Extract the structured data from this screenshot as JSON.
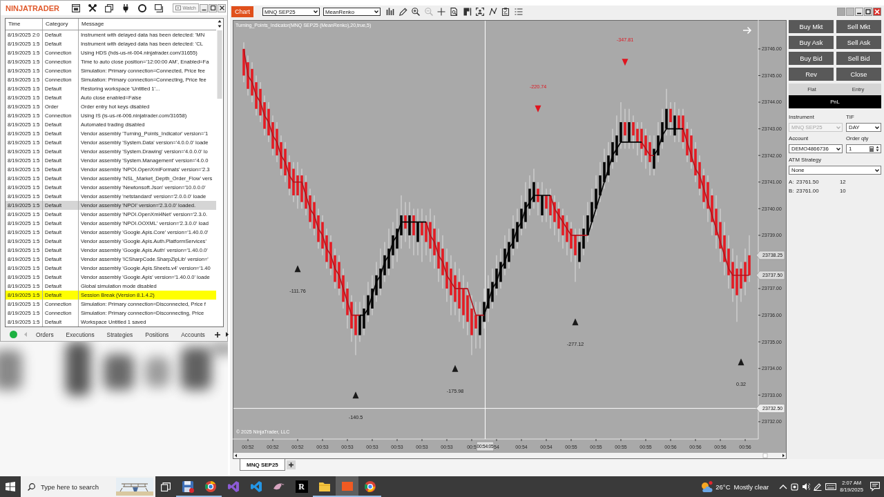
{
  "control_center": {
    "logo": "NINJATRADER",
    "watch_button": "Watch",
    "log": {
      "columns": [
        "Time",
        "Category",
        "Message"
      ],
      "rows": [
        {
          "time": "8/19/2025 2:0",
          "category": "Default",
          "message": "Instrument with delayed data has been detected: 'MN",
          "selected": false
        },
        {
          "time": "8/19/2025 1:5",
          "category": "Default",
          "message": "Instrument with delayed data has been detected: 'CL",
          "selected": false
        },
        {
          "time": "8/19/2025 1:5",
          "category": "Connection",
          "message": "Using HDS (hds-us-nt-004.ninjatrader.com/31655)",
          "selected": false
        },
        {
          "time": "8/19/2025 1:5",
          "category": "Connection",
          "message": "Time to auto close position='12:00:00 AM', Enabled=Fa",
          "selected": false
        },
        {
          "time": "8/19/2025 1:5",
          "category": "Connection",
          "message": "Simulation: Primary connection=Connected, Price fee",
          "selected": false
        },
        {
          "time": "8/19/2025 1:5",
          "category": "Connection",
          "message": "Simulation: Primary connection=Connecting, Price fee",
          "selected": false
        },
        {
          "time": "8/19/2025 1:5",
          "category": "Default",
          "message": "Restoring workspace 'Untitled 1'...",
          "selected": false
        },
        {
          "time": "8/19/2025 1:5",
          "category": "Default",
          "message": "Auto close enabled=False",
          "selected": false
        },
        {
          "time": "8/19/2025 1:5",
          "category": "Order",
          "message": "Order entry hot keys disabled",
          "selected": false
        },
        {
          "time": "8/19/2025 1:5",
          "category": "Connection",
          "message": "Using IS (is-us-nt-006.ninjatrader.com/31658)",
          "selected": false
        },
        {
          "time": "8/19/2025 1:5",
          "category": "Default",
          "message": "Automated trading disabled",
          "selected": false
        },
        {
          "time": "8/19/2025 1:5",
          "category": "Default",
          "message": "Vendor assembly 'Turning_Points_Indicator' version='1",
          "selected": false
        },
        {
          "time": "8/19/2025 1:5",
          "category": "Default",
          "message": "Vendor assembly 'System.Data' version='4.0.0.0' loade",
          "selected": false
        },
        {
          "time": "8/19/2025 1:5",
          "category": "Default",
          "message": "Vendor assembly 'System.Drawing' version='4.0.0.0' lo",
          "selected": false
        },
        {
          "time": "8/19/2025 1:5",
          "category": "Default",
          "message": "Vendor assembly 'System.Management' version='4.0.0",
          "selected": false
        },
        {
          "time": "8/19/2025 1:5",
          "category": "Default",
          "message": "Vendor assembly 'NPOI.OpenXmlFormats' version='2.3",
          "selected": false
        },
        {
          "time": "8/19/2025 1:5",
          "category": "Default",
          "message": "Vendor assembly 'NSL_Market_Depth_Order_Flow' vers",
          "selected": false
        },
        {
          "time": "8/19/2025 1:5",
          "category": "Default",
          "message": "Vendor assembly 'Newtonsoft.Json' version='10.0.0.0'",
          "selected": false
        },
        {
          "time": "8/19/2025 1:5",
          "category": "Default",
          "message": "Vendor assembly 'netstandard' version='2.0.0.0' loade",
          "selected": false
        },
        {
          "time": "8/19/2025 1:5",
          "category": "Default",
          "message": "Vendor assembly 'NPOI' version='2.3.0.0' loaded.",
          "selected": true
        },
        {
          "time": "8/19/2025 1:5",
          "category": "Default",
          "message": "Vendor assembly 'NPOI.OpenXml4Net' version='2.3.0.",
          "selected": false
        },
        {
          "time": "8/19/2025 1:5",
          "category": "Default",
          "message": "Vendor assembly 'NPOI.OOXML' version='2.3.0.0' load",
          "selected": false
        },
        {
          "time": "8/19/2025 1:5",
          "category": "Default",
          "message": "Vendor assembly 'Google.Apis.Core' version='1.40.0.0'",
          "selected": false
        },
        {
          "time": "8/19/2025 1:5",
          "category": "Default",
          "message": "Vendor assembly 'Google.Apis.Auth.PlatformServices'",
          "selected": false
        },
        {
          "time": "8/19/2025 1:5",
          "category": "Default",
          "message": "Vendor assembly 'Google.Apis.Auth' version='1.40.0.0'",
          "selected": false
        },
        {
          "time": "8/19/2025 1:5",
          "category": "Default",
          "message": "Vendor assembly 'ICSharpCode.SharpZipLib' version='",
          "selected": false
        },
        {
          "time": "8/19/2025 1:5",
          "category": "Default",
          "message": "Vendor assembly 'Google.Apis.Sheets.v4' version='1.40",
          "selected": false
        },
        {
          "time": "8/19/2025 1:5",
          "category": "Default",
          "message": "Vendor assembly 'Google.Apis' version='1.40.0.0' loade",
          "selected": false
        },
        {
          "time": "8/19/2025 1:5",
          "category": "Default",
          "message": "Global simulation mode disabled",
          "selected": false
        },
        {
          "time": "8/19/2025 1:5",
          "category": "Default",
          "message": "Session Break (Version 8.1.4.2)",
          "selected": false,
          "color": "#ffff00"
        },
        {
          "time": "8/19/2025 1:5",
          "category": "Connection",
          "message": "Simulation: Primary connection=Disconnected, Price f",
          "selected": false
        },
        {
          "time": "8/19/2025 1:5",
          "category": "Connection",
          "message": "Simulation: Primary connection=Disconnecting, Price",
          "selected": false
        },
        {
          "time": "8/19/2025 1:5",
          "category": "Default",
          "message": "Workspace Untitled 1 saved",
          "selected": false
        }
      ]
    },
    "connected": true,
    "tabs": [
      {
        "label": "Orders",
        "selected": false
      },
      {
        "label": "Executions",
        "selected": false
      },
      {
        "label": "Strategies",
        "selected": false
      },
      {
        "label": "Positions",
        "selected": false
      },
      {
        "label": "Accounts",
        "selected": false
      }
    ]
  },
  "chart_window": {
    "chart_label": "Chart",
    "instrument": "MNQ SEP25",
    "bar_type": "MeanRenko",
    "tools": [
      {
        "kind": "bars",
        "disabled": false
      },
      {
        "kind": "pencil",
        "disabled": false
      },
      {
        "kind": "zoom-in",
        "disabled": false
      },
      {
        "kind": "zoom-out",
        "disabled": true
      },
      {
        "kind": "crosshair",
        "disabled": false
      },
      {
        "kind": "data-box",
        "disabled": false
      },
      {
        "kind": "flag",
        "disabled": false
      },
      {
        "kind": "capture",
        "disabled": false
      },
      {
        "kind": "zigzag",
        "disabled": false
      },
      {
        "kind": "clipboard",
        "disabled": false
      },
      {
        "kind": "list",
        "disabled": false
      }
    ],
    "chart": {
      "copyright": "© 2025 NinjaTrader, LLC",
      "crosshair_time": "00:54:05",
      "chart_data": {
        "type": "candlestick",
        "title": "Turning_Points_Indicator(MNQ SEP25 (MeanRenko),20,true,5)",
        "categories": [
          null,
          "00:52",
          null,
          null,
          null,
          null,
          null,
          "00:52",
          null,
          null,
          null,
          null,
          null,
          "00:52",
          null,
          null,
          null,
          null,
          null,
          "00:53",
          null,
          null,
          null,
          null,
          null,
          "00:53",
          null,
          null,
          null,
          null,
          null,
          "00:53",
          null,
          null,
          null,
          null,
          null,
          "00:53",
          null,
          null,
          null,
          null,
          null,
          "00:53",
          null,
          null,
          null,
          null,
          null,
          "00:53",
          null,
          null,
          null,
          null,
          null,
          "00:5",
          null,
          null,
          null,
          null,
          null,
          "54",
          null,
          null,
          null,
          null,
          null,
          "00:54",
          null,
          null,
          null,
          null,
          null,
          "00:54",
          null,
          null,
          null,
          null,
          null,
          "00:55",
          null,
          null,
          null,
          null,
          null,
          "00:55",
          null,
          null,
          null,
          null,
          null,
          "00:55",
          null,
          null,
          null,
          null,
          null,
          "00:55",
          null,
          null,
          null,
          null,
          null,
          "00:56",
          null,
          null,
          null,
          null,
          null,
          "00:56",
          null,
          null,
          null,
          null,
          null,
          "00:56",
          null,
          null,
          null,
          null,
          null,
          "00:56",
          null
        ],
        "ohlc": [
          [
            23746,
            23746.25,
            23744.75,
            23745
          ],
          [
            23745.5,
            23745.75,
            23744.25,
            23744.5
          ],
          [
            23745.25,
            23745.5,
            23744,
            23744.25
          ],
          [
            23744.75,
            23745,
            23743.5,
            23743.75
          ],
          [
            23744.5,
            23744.75,
            23743.25,
            23743.5
          ],
          [
            23744,
            23744.25,
            23742.75,
            23743
          ],
          [
            23743.75,
            23744,
            23742.5,
            23742.75
          ],
          [
            23743.25,
            23743.5,
            23742,
            23742.25
          ],
          [
            23743,
            23743.25,
            23741.75,
            23742
          ],
          [
            23742.5,
            23742.75,
            23741.25,
            23741.5
          ],
          [
            23742.25,
            23742.5,
            23741,
            23741.25
          ],
          [
            23741.75,
            23742,
            23740.5,
            23740.75
          ],
          [
            23741.5,
            23741.75,
            23740.25,
            23740.5
          ],
          [
            23741.25,
            23741.75,
            23740,
            23740.5
          ],
          [
            23741.25,
            23741.5,
            23740,
            23740.25
          ],
          [
            23741,
            23741.25,
            23739.75,
            23740
          ],
          [
            23740.5,
            23740.75,
            23739.25,
            23739.5
          ],
          [
            23740.25,
            23740.5,
            23739,
            23739.25
          ],
          [
            23739.75,
            23740,
            23738.5,
            23738.75
          ],
          [
            23739.5,
            23739.75,
            23738.25,
            23738.5
          ],
          [
            23739,
            23739.25,
            23737.75,
            23738
          ],
          [
            23738.75,
            23739,
            23737.5,
            23737.75
          ],
          [
            23738.25,
            23738.5,
            23737,
            23737.25
          ],
          [
            23738,
            23738.25,
            23736.75,
            23737
          ],
          [
            23737.5,
            23737.75,
            23736.25,
            23736.5
          ],
          [
            23737,
            23737.25,
            23735.5,
            23736
          ],
          [
            23736.5,
            23736.75,
            23735,
            23735.5
          ],
          [
            23736,
            23736.5,
            23734.5,
            23735.25
          ],
          [
            23735.25,
            23736.5,
            23735,
            23736
          ],
          [
            23735.5,
            23736.75,
            23735.25,
            23736.25
          ],
          [
            23736,
            23737.25,
            23735.75,
            23736.75
          ],
          [
            23736.25,
            23737.5,
            23736,
            23737
          ],
          [
            23736.75,
            23738,
            23736.5,
            23737.5
          ],
          [
            23737,
            23738.5,
            23736.75,
            23737.75
          ],
          [
            23737.5,
            23738.75,
            23737.25,
            23738.25
          ],
          [
            23737.75,
            23739.25,
            23737.5,
            23738.5
          ],
          [
            23738.25,
            23739.5,
            23737.75,
            23739
          ],
          [
            23738.5,
            23740,
            23738,
            23739.25
          ],
          [
            23739,
            23740.5,
            23738.5,
            23739.75
          ],
          [
            23739.75,
            23740.25,
            23738.75,
            23739.25
          ],
          [
            23739,
            23740.25,
            23738.5,
            23739.75
          ],
          [
            23739.75,
            23740,
            23738.25,
            23739
          ],
          [
            23738.75,
            23740,
            23738.25,
            23739.5
          ],
          [
            23739.5,
            23740,
            23738,
            23739
          ],
          [
            23739.5,
            23739.75,
            23738.25,
            23738.75
          ],
          [
            23739.5,
            23740,
            23738,
            23738.5
          ],
          [
            23739.25,
            23739.75,
            23737.75,
            23738.25
          ],
          [
            23738.75,
            23739.25,
            23737.25,
            23737.75
          ],
          [
            23738.5,
            23739,
            23737,
            23737.5
          ],
          [
            23738,
            23738.5,
            23736.5,
            23737
          ],
          [
            23737.75,
            23738.25,
            23736,
            23736.75
          ],
          [
            23737.5,
            23738,
            23736,
            23736.5
          ],
          [
            23737.25,
            23737.75,
            23735.75,
            23736.25
          ],
          [
            23737,
            23737.5,
            23735.5,
            23736
          ],
          [
            23736.75,
            23737.25,
            23735.25,
            23735.75
          ],
          [
            23736.25,
            23736.75,
            23734.5,
            23735.25
          ],
          [
            23736,
            23736.5,
            23734.75,
            23735.5
          ],
          [
            23735.25,
            23736.5,
            23734.75,
            23736
          ],
          [
            23735.75,
            23737,
            23735.5,
            23736.5
          ],
          [
            23736.25,
            23737.5,
            23735.75,
            23737
          ],
          [
            23736.5,
            23737.75,
            23736.25,
            23737.25
          ],
          [
            23737,
            23738.25,
            23736.75,
            23737.75
          ],
          [
            23737.25,
            23738.5,
            23737,
            23738
          ],
          [
            23737.75,
            23739,
            23737.5,
            23738.5
          ],
          [
            23738,
            23739.25,
            23737.75,
            23738.75
          ],
          [
            23738.5,
            23739.75,
            23738.25,
            23739.25
          ],
          [
            23738.75,
            23740,
            23738.5,
            23739.5
          ],
          [
            23739.25,
            23740.5,
            23739,
            23740
          ],
          [
            23739.5,
            23741,
            23739.25,
            23740.25
          ],
          [
            23740,
            23741.25,
            23739.75,
            23740.75
          ],
          [
            23740.25,
            23741.5,
            23740,
            23741
          ],
          [
            23740.75,
            23741,
            23739.75,
            23740.25
          ],
          [
            23739.75,
            23741,
            23739.5,
            23740.5
          ],
          [
            23740.5,
            23740.75,
            23739.5,
            23740
          ],
          [
            23740.5,
            23740.75,
            23739.25,
            23739.75
          ],
          [
            23740.25,
            23740.5,
            23739,
            23739.5
          ],
          [
            23740,
            23740.25,
            23738.75,
            23739.25
          ],
          [
            23739.75,
            23740,
            23738.5,
            23739
          ],
          [
            23739.5,
            23739.75,
            23738.25,
            23738.75
          ],
          [
            23739.25,
            23739.5,
            23738,
            23738.5
          ],
          [
            23739,
            23739.25,
            23737.25,
            23738.25
          ],
          [
            23738,
            23739.25,
            23737.75,
            23738.75
          ],
          [
            23738.5,
            23739.75,
            23738.25,
            23739.25
          ],
          [
            23739,
            23740.25,
            23738.75,
            23739.75
          ],
          [
            23739.5,
            23740.75,
            23739.25,
            23740.25
          ],
          [
            23740,
            23741.25,
            23739.75,
            23740.75
          ],
          [
            23740.5,
            23741.75,
            23740.25,
            23741.25
          ],
          [
            23741,
            23742.25,
            23740.75,
            23741.75
          ],
          [
            23741.25,
            23742.5,
            23741,
            23742
          ],
          [
            23741.75,
            23743,
            23741.5,
            23742.5
          ],
          [
            23742,
            23743.5,
            23741.75,
            23742.75
          ],
          [
            23742.5,
            23744,
            23742.25,
            23743.25
          ],
          [
            23743.25,
            23743.75,
            23742.25,
            23742.75
          ],
          [
            23742.5,
            23743.75,
            23742.25,
            23743.25
          ],
          [
            23743.25,
            23743.5,
            23742.25,
            23742.75
          ],
          [
            23743,
            23743.25,
            23742,
            23742.5
          ],
          [
            23743,
            23743.25,
            23741.75,
            23742.25
          ],
          [
            23742.75,
            23743,
            23741.5,
            23742
          ],
          [
            23742.5,
            23742.75,
            23741.25,
            23741.75
          ],
          [
            23741.5,
            23742.75,
            23741.25,
            23742.25
          ],
          [
            23742,
            23743.25,
            23741.75,
            23742.75
          ],
          [
            23742.5,
            23743.75,
            23742.25,
            23743.25
          ],
          [
            23743,
            23744.5,
            23742.75,
            23743.75
          ],
          [
            23743.75,
            23744,
            23742.75,
            23743.25
          ],
          [
            23742.75,
            23744,
            23742.5,
            23743.5
          ],
          [
            23743.5,
            23743.75,
            23742.5,
            23743
          ],
          [
            23743.5,
            23743.75,
            23742.25,
            23742.5
          ],
          [
            23743,
            23743.25,
            23741.75,
            23742
          ],
          [
            23742.75,
            23743,
            23741.5,
            23741.75
          ],
          [
            23742.25,
            23742.5,
            23741,
            23741.25
          ],
          [
            23741.75,
            23742,
            23740.5,
            23740.75
          ],
          [
            23741.25,
            23741.5,
            23740,
            23740.25
          ],
          [
            23741,
            23741.25,
            23739.5,
            23740
          ],
          [
            23740.5,
            23740.75,
            23739,
            23739.5
          ],
          [
            23740,
            23740.5,
            23738.5,
            23739
          ],
          [
            23739.5,
            23740,
            23738,
            23738.5
          ],
          [
            23739,
            23739.5,
            23737.5,
            23738
          ],
          [
            23738.5,
            23739,
            23737,
            23737.5
          ],
          [
            23738,
            23738.5,
            23736.5,
            23737
          ],
          [
            23737.75,
            23738.25,
            23735.75,
            23736.75
          ],
          [
            23737.75,
            23738,
            23736.5,
            23737
          ],
          [
            23738,
            23738.5,
            23736.75,
            23737.25
          ],
          [
            23738.25,
            23739,
            23737.25,
            23737.5
          ]
        ],
        "series": [
          {
            "type": "line",
            "color": "#b3121b",
            "values": [
              23746,
              23745,
              23744.75,
              23744.25,
              23744,
              23743.5,
              23743.25,
              23742.75,
              23742.5,
              23742,
              23741.75,
              23741.25,
              23741,
              23741,
              23741,
              23740.5,
              23740,
              23739.75,
              23739.25,
              23739,
              23738.5,
              23738.25,
              23737.75,
              23737.5,
              23737,
              23736.5,
              23736,
              23736,
              23736,
              null,
              null,
              null,
              null,
              null,
              null,
              null,
              null,
              null,
              null,
              null,
              null,
              null,
              null,
              null,
              23739.5,
              23739,
              23738.75,
              23738.25,
              23738,
              23737.5,
              23737.25,
              23737,
              23737,
              23737,
              23737,
              23736.5,
              23736,
              23736,
              23736,
              null,
              null,
              null,
              null,
              null,
              null,
              null,
              null,
              null,
              null,
              null,
              null,
              null,
              null,
              null,
              23740.5,
              23740,
              23739.75,
              23739.5,
              23739.25,
              23739,
              23739,
              23739,
              23739,
              23739,
              null,
              null,
              null,
              null,
              null,
              null,
              null,
              null,
              null,
              null,
              null,
              null,
              23742.5,
              23742.25,
              23742,
              23742,
              null,
              null,
              null,
              null,
              null,
              null,
              23743,
              23742.5,
              23742,
              23741.5,
              23741.25,
              23740.75,
              23740.25,
              23739.75,
              23739.25,
              23738.75,
              23738.25,
              23737.75,
              23737.5,
              23737.5,
              23737.5,
              23737.5,
              23737.5
            ]
          },
          {
            "type": "line",
            "color": "#000000",
            "values": [
              null,
              null,
              null,
              null,
              null,
              null,
              null,
              null,
              null,
              null,
              null,
              null,
              null,
              null,
              null,
              null,
              null,
              null,
              null,
              null,
              null,
              null,
              null,
              null,
              null,
              null,
              null,
              null,
              23736,
              23736,
              23736.25,
              23736.75,
              23737.25,
              23737.5,
              23738,
              23738.25,
              23738.75,
              23739,
              23739.5,
              23739.5,
              23739.5,
              23739.5,
              23739.5,
              23739.5,
              23739.5,
              null,
              null,
              null,
              null,
              null,
              null,
              null,
              null,
              null,
              null,
              null,
              null,
              null,
              23736,
              23736.5,
              23737,
              23737.25,
              23737.75,
              23738,
              23738.5,
              23738.75,
              23739.25,
              23739.5,
              23740,
              23740.25,
              23740.5,
              23740.5,
              23740.5,
              23740.5,
              23740.5,
              null,
              null,
              null,
              null,
              null,
              null,
              null,
              null,
              23739,
              23739.5,
              23740,
              23740.5,
              23741,
              23741.5,
              23742,
              23742.25,
              23742.5,
              23742.5,
              23742.5,
              23742.5,
              23742.5,
              23742.5,
              null,
              null,
              23742,
              23742.25,
              23742.75,
              23743,
              23743,
              23743,
              23743,
              23743,
              null,
              null,
              null,
              null,
              null,
              null,
              null,
              null,
              null,
              null,
              null,
              null,
              null,
              null,
              null,
              null
            ]
          },
          {
            "type": "scatter",
            "marker": "triangle",
            "color": "#1a1a1a",
            "values": [
              null,
              null,
              null,
              null,
              null,
              null,
              null,
              null,
              null,
              null,
              null,
              null,
              null,
              23737.75,
              null,
              null,
              null,
              null,
              null,
              null,
              null,
              null,
              null,
              null,
              null,
              null,
              null,
              23733,
              null,
              null,
              null,
              null,
              null,
              null,
              null,
              null,
              null,
              null,
              null,
              null,
              null,
              null,
              null,
              null,
              null,
              null,
              null,
              null,
              null,
              null,
              null,
              23734,
              null,
              null,
              null,
              null,
              null,
              null,
              null,
              null,
              null,
              null,
              null,
              null,
              null,
              null,
              null,
              null,
              null,
              null,
              null,
              null,
              null,
              null,
              null,
              null,
              null,
              null,
              null,
              null,
              23735.75,
              null,
              null,
              null,
              null,
              null,
              null,
              null,
              null,
              null,
              null,
              null,
              null,
              null,
              null,
              null,
              null,
              null,
              null,
              null,
              null,
              null,
              null,
              null,
              null,
              null,
              null,
              null,
              null,
              null,
              null,
              null,
              null,
              null,
              null,
              null,
              null,
              null,
              null,
              null,
              23734.25,
              null,
              null
            ]
          },
          {
            "type": "scatter",
            "marker": "triangle",
            "color": "#e0141e",
            "values": [
              null,
              null,
              null,
              null,
              null,
              null,
              null,
              null,
              null,
              null,
              null,
              null,
              null,
              null,
              null,
              null,
              null,
              null,
              null,
              null,
              null,
              null,
              null,
              null,
              null,
              null,
              null,
              null,
              null,
              null,
              null,
              null,
              null,
              null,
              null,
              null,
              null,
              null,
              null,
              null,
              null,
              null,
              null,
              null,
              null,
              null,
              null,
              null,
              null,
              null,
              null,
              null,
              null,
              null,
              null,
              null,
              null,
              null,
              null,
              null,
              null,
              null,
              null,
              null,
              null,
              null,
              null,
              null,
              null,
              null,
              null,
              23743.75,
              null,
              null,
              null,
              null,
              null,
              null,
              null,
              null,
              null,
              null,
              null,
              null,
              null,
              null,
              null,
              null,
              null,
              null,
              null,
              null,
              23745.5,
              null,
              null,
              null,
              null,
              null,
              null,
              null,
              null,
              null,
              null,
              null,
              null,
              null,
              null,
              null,
              null,
              null,
              null,
              null,
              null,
              null,
              null,
              null,
              null,
              null,
              null,
              null,
              null,
              null,
              null
            ]
          }
        ],
        "annotations": [
          "-111.76",
          "-140.5",
          "-175.98",
          "-277.12",
          "0.32",
          "-220.74",
          "-347.81"
        ],
        "ylim": [
          23731.35,
          23747.06
        ],
        "yticks": [
          {
            "value": 23732,
            "label": "23732.00"
          },
          {
            "value": 23733,
            "label": "23733.00"
          },
          {
            "value": 23734,
            "label": "23734.00"
          },
          {
            "value": 23735,
            "label": "23735.00"
          },
          {
            "value": 23736,
            "label": "23736.00"
          },
          {
            "value": 23737,
            "label": "23737.00"
          },
          {
            "value": 23737.5,
            "label": "23737.50"
          },
          {
            "value": 23738.25,
            "label": "23738.25"
          },
          {
            "value": 23739,
            "label": "23739.00"
          },
          {
            "value": 23740,
            "label": "23740.00"
          },
          {
            "value": 23741,
            "label": "23741.00"
          },
          {
            "value": 23742,
            "label": "23742.00"
          },
          {
            "value": 23743,
            "label": "23743.00"
          },
          {
            "value": 23744,
            "label": "23744.00"
          },
          {
            "value": 23745,
            "label": "23745.00"
          },
          {
            "value": 23746,
            "label": "23746.00"
          }
        ],
        "ref_lines": [
          {
            "axis": "y",
            "value": 23732.5,
            "label": "23732.50",
            "color": "#ffffff"
          }
        ]
      }
    },
    "chart_trader": {
      "buttons": [
        "Buy Mkt",
        "Sell Mkt",
        "Buy Ask",
        "Sell Ask",
        "Buy Bid",
        "Sell Bid",
        "Rev",
        "Close"
      ],
      "position_columns": [
        "Flat",
        "Entry"
      ],
      "pnl": "PnL",
      "instrument_label": "Instrument",
      "instrument": {
        "value": "MNQ SEP25",
        "disabled": true
      },
      "tif_label": "TIF",
      "tif": "DAY",
      "account_label": "Account",
      "account": "DEMO4866736",
      "quantity_label": "Order qty",
      "quantity": "1",
      "atm_label": "ATM Strategy",
      "atm_strategy": "None",
      "quotes": [
        {
          "side": "A:",
          "price": "23761.50",
          "size": "12"
        },
        {
          "side": "B:",
          "price": "23761.00",
          "size": "10"
        }
      ]
    },
    "tabs": [
      {
        "label": "MNQ SEP25",
        "selected": true
      }
    ]
  },
  "taskbar": {
    "search": {
      "placeholder": "Type here to search"
    },
    "apps": [
      {
        "kind": "floppy",
        "running": true,
        "active": false
      },
      {
        "kind": "ringbrowser",
        "running": true,
        "active": false
      },
      {
        "kind": "ribbon",
        "running": false,
        "active": false
      },
      {
        "kind": "editor",
        "running": false,
        "active": false
      },
      {
        "kind": "bird",
        "running": false,
        "active": false
      },
      {
        "kind": "letter",
        "label": "R",
        "running": false,
        "active": false
      },
      {
        "kind": "folder",
        "running": true,
        "active": false
      },
      {
        "kind": "tile",
        "running": true,
        "active": true
      },
      {
        "kind": "browser",
        "running": true,
        "active": false
      }
    ],
    "weather": {
      "temperature": "26°C",
      "condition": "Mostly clear"
    },
    "clock": {
      "time": "2:07 AM",
      "date": "8/19/2025"
    }
  }
}
